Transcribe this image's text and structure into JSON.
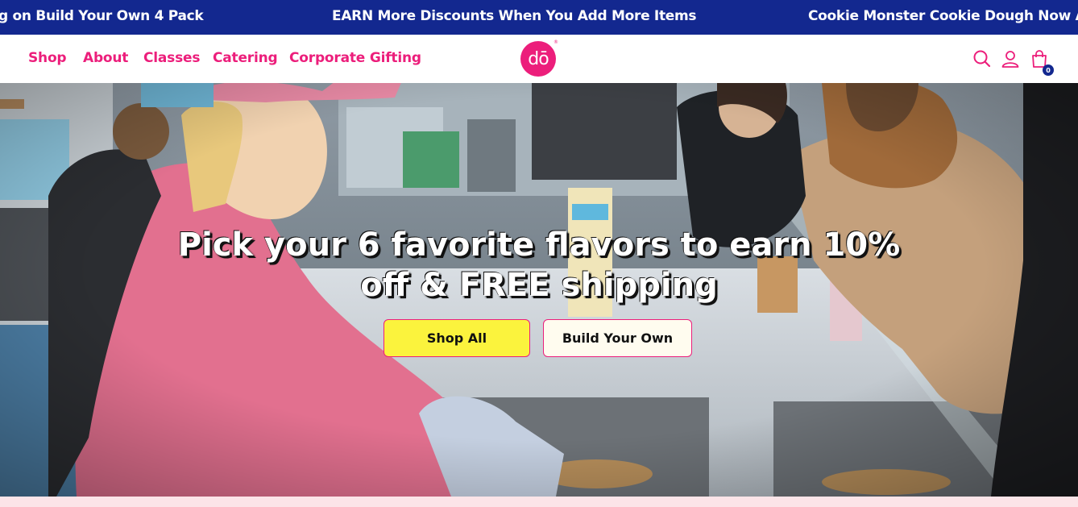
{
  "announcement": {
    "messages": [
      "g on Build Your Own 4 Pack",
      "EARN More Discounts When You Add More Items",
      "Cookie Monster Cookie Dough Now Avail"
    ],
    "background": "#13288f"
  },
  "nav": {
    "items": [
      "Shop",
      "About",
      "Classes",
      "Catering",
      "Corporate Gifting"
    ],
    "color": "#ec1e7b"
  },
  "logo": {
    "text": "dō",
    "mark": "®"
  },
  "header_icons": [
    "search-icon",
    "account-icon",
    "cart-icon"
  ],
  "cart": {
    "count": "0"
  },
  "hero": {
    "title_line1": "Pick your 6 favorite flavors to earn 10%",
    "title_line2": "off & FREE shipping",
    "buttons": {
      "shop_all": "Shop All",
      "build_your_own": "Build Your Own"
    },
    "colors": {
      "primary_button": "#fbf33d",
      "secondary_button": "#fffcef",
      "button_border": "#ec1e7b"
    }
  }
}
